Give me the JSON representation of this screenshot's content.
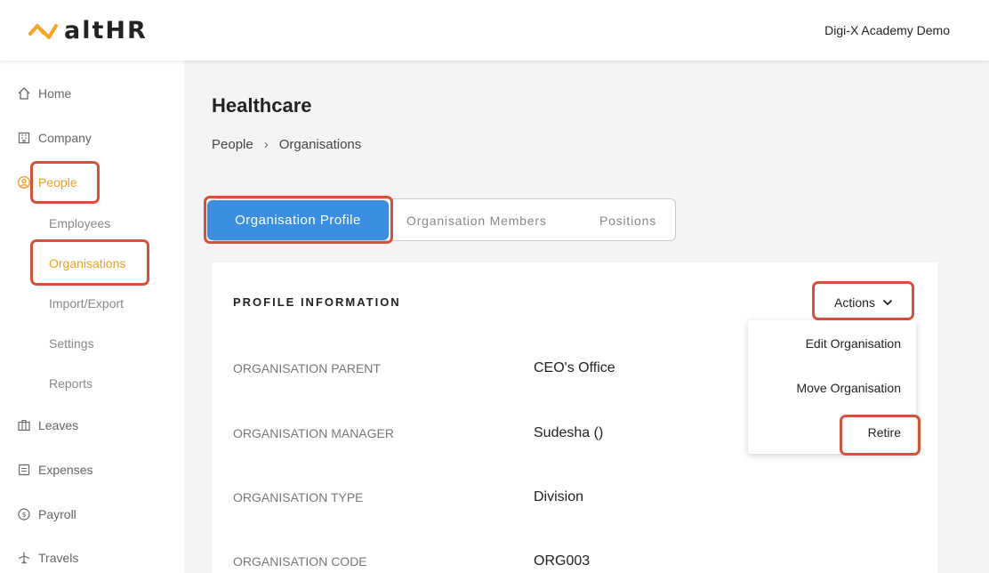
{
  "header": {
    "logo_text": "altHR",
    "company": "Digi-X Academy Demo"
  },
  "sidebar": {
    "items": [
      {
        "label": "Home",
        "icon": "home-icon"
      },
      {
        "label": "Company",
        "icon": "building-icon"
      },
      {
        "label": "People",
        "icon": "person-circle-icon"
      },
      {
        "label": "Leaves",
        "icon": "briefcase-icon"
      },
      {
        "label": "Expenses",
        "icon": "receipt-icon"
      },
      {
        "label": "Payroll",
        "icon": "dollar-circle-icon"
      },
      {
        "label": "Travels",
        "icon": "plane-icon"
      }
    ],
    "people_sub": [
      {
        "label": "Employees"
      },
      {
        "label": "Organisations"
      },
      {
        "label": "Import/Export"
      },
      {
        "label": "Settings"
      },
      {
        "label": "Reports"
      }
    ]
  },
  "main": {
    "title": "Healthcare",
    "breadcrumb": [
      "People",
      "Organisations"
    ],
    "tabs": [
      {
        "label": "Organisation Profile"
      },
      {
        "label": "Organisation Members"
      },
      {
        "label": "Positions"
      }
    ],
    "section_title": "PROFILE INFORMATION",
    "actions_label": "Actions",
    "actions_menu": [
      {
        "label": "Edit Organisation"
      },
      {
        "label": "Move Organisation"
      },
      {
        "label": "Retire"
      }
    ],
    "fields": [
      {
        "label": "ORGANISATION PARENT",
        "value": "CEO's Office"
      },
      {
        "label": "ORGANISATION MANAGER",
        "value": "Sudesha ()"
      },
      {
        "label": "ORGANISATION TYPE",
        "value": "Division"
      },
      {
        "label": "ORGANISATION CODE",
        "value": "ORG003"
      }
    ]
  },
  "colors": {
    "accent": "#f0a020",
    "active_tab": "#3a8fe0",
    "highlight": "#d9503a"
  }
}
